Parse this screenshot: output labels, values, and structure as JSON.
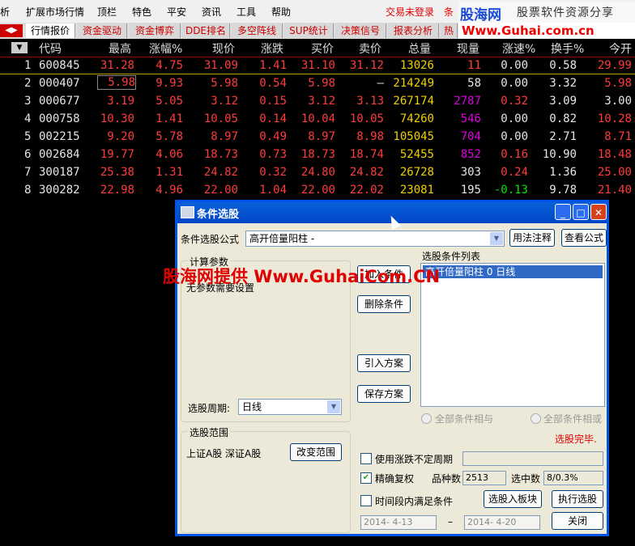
{
  "menu": [
    "析",
    "扩展市场行情",
    "顶栏",
    "特色",
    "平安",
    "资讯",
    "工具",
    "帮助"
  ],
  "login_status": "交易未登录",
  "menu_tail": "条",
  "logo": {
    "brand": "股海网",
    "slogan": "股票软件资源分享",
    "url": "Www.Guhai.com.cn"
  },
  "tabs": [
    "行情报价",
    "资金驱动",
    "资金博弈",
    "DDE排名",
    "多空阵线",
    "SUP统计",
    "决策信号",
    "报表分析",
    "热"
  ],
  "columns": [
    "代码",
    "最高",
    "涨幅%",
    "现价",
    "涨跌",
    "买价",
    "卖价",
    "总量",
    "现量",
    "涨速%",
    "换手%",
    "今开"
  ],
  "rows": [
    {
      "idx": "1",
      "code": "600845",
      "high": "31.28",
      "pct": "4.75",
      "price": "31.09",
      "chg": "1.41",
      "bid": "31.10",
      "ask": "31.12",
      "vol": "13026",
      "cur": "11",
      "spd": "0.00",
      "turn": "0.58",
      "open": "29.99"
    },
    {
      "idx": "2",
      "code": "000407",
      "high": "5.98",
      "pct": "9.93",
      "price": "5.98",
      "chg": "0.54",
      "bid": "5.98",
      "ask": "–",
      "vol": "214249",
      "cur": "58",
      "spd": "0.00",
      "turn": "3.32",
      "open": "5.98"
    },
    {
      "idx": "3",
      "code": "000677",
      "high": "3.19",
      "pct": "5.05",
      "price": "3.12",
      "chg": "0.15",
      "bid": "3.12",
      "ask": "3.13",
      "vol": "267174",
      "cur": "2787",
      "spd": "0.32",
      "turn": "3.09",
      "open": "3.00"
    },
    {
      "idx": "4",
      "code": "000758",
      "high": "10.30",
      "pct": "1.41",
      "price": "10.05",
      "chg": "0.14",
      "bid": "10.04",
      "ask": "10.05",
      "vol": "74260",
      "cur": "546",
      "spd": "0.00",
      "turn": "0.82",
      "open": "10.28"
    },
    {
      "idx": "5",
      "code": "002215",
      "high": "9.20",
      "pct": "5.78",
      "price": "8.97",
      "chg": "0.49",
      "bid": "8.97",
      "ask": "8.98",
      "vol": "105045",
      "cur": "704",
      "spd": "0.00",
      "turn": "2.71",
      "open": "8.71"
    },
    {
      "idx": "6",
      "code": "002684",
      "high": "19.77",
      "pct": "4.06",
      "price": "18.73",
      "chg": "0.73",
      "bid": "18.73",
      "ask": "18.74",
      "vol": "52455",
      "cur": "852",
      "spd": "0.16",
      "turn": "10.90",
      "open": "18.48"
    },
    {
      "idx": "7",
      "code": "300187",
      "high": "25.38",
      "pct": "1.31",
      "price": "24.82",
      "chg": "0.32",
      "bid": "24.80",
      "ask": "24.82",
      "vol": "26728",
      "cur": "303",
      "spd": "0.24",
      "turn": "1.36",
      "open": "25.00"
    },
    {
      "idx": "8",
      "code": "300282",
      "high": "22.98",
      "pct": "4.96",
      "price": "22.00",
      "chg": "1.04",
      "bid": "22.00",
      "ask": "22.02",
      "vol": "23081",
      "cur": "195",
      "spd": "-0.13",
      "turn": "9.78",
      "open": "21.40"
    }
  ],
  "dialog": {
    "title": "条件选股",
    "formula_label": "条件选股公式",
    "formula_value": "高开倍量阳柱 -",
    "btn_usage": "用法注释",
    "btn_view": "查看公式",
    "params_title": "计算参数",
    "params_note": "无参数需要设置",
    "period_label": "选股周期:",
    "period_value": "日线",
    "btn_add": "加入条件",
    "btn_delete": "删除条件",
    "btn_import": "引入方案",
    "btn_save": "保存方案",
    "list_title": "选股条件列表",
    "list_item": "高开倍量阳柱  0  日线",
    "radio_and": "全部条件相与",
    "radio_or": "全部条件相或",
    "status": "选股完毕.",
    "range_title": "选股范围",
    "range_value": "上证A股 深证A股",
    "btn_range": "改变范围",
    "chk_period": "使用涨跌不定周期",
    "chk_adjust": "精确复权",
    "chk_adjust_mark": "✔",
    "count_label": "品种数",
    "count_value": "2513",
    "selected_label": "选中数",
    "selected_value": "8/0.3%",
    "chk_time": "时间段内满足条件",
    "btn_to_block": "选股入板块",
    "btn_execute": "执行选股",
    "date_from": "2014- 4-13",
    "date_sep": "–",
    "date_to": "2014- 4-20",
    "btn_close": "关闭"
  },
  "watermark": "股海网提供 Www.GuhaiCom.CN"
}
